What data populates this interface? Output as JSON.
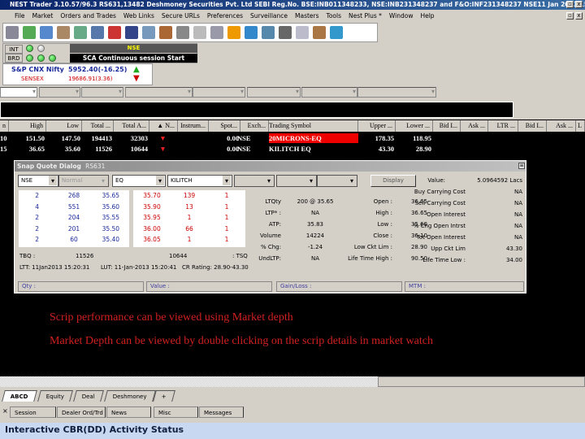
{
  "app": {
    "title": "NEST Trader 3.10.57/96.3 RS631,13482 Deshmoney Securities Pvt. Ltd SEBI Reg.No. BSE:INB011348233, NSE:INB231348237 and F&O:INF231348237 NSE11 Jan 2013 15..."
  },
  "menu": [
    "File",
    "Market",
    "Orders and Trades",
    "Web Links",
    "Secure URLs",
    "Preferences",
    "Surveillance",
    "Masters",
    "Tools",
    "Nest Plus *",
    "Window",
    "Help"
  ],
  "status": {
    "int_label": "INT",
    "brd_label": "BRD",
    "exchange": "NSE",
    "message": "SCA Continuous session Start"
  },
  "ticker": {
    "nifty_name": "S&P CNX Nifty",
    "nifty_value": "5952.40(-16.25)",
    "sensex_name": "SENSEX",
    "sensex_value": "19686.91(3.36)"
  },
  "grid": {
    "headers": [
      "n",
      "High",
      "Low",
      "Total ...",
      "Total A...",
      "▲ N...",
      "Instrum...",
      "Spot...",
      "Exch...",
      "Trading Symbol",
      "Upper ...",
      "Lower ...",
      "Bid I...",
      "Ask ...",
      "LTR ...",
      "Bid I...",
      "Ask ...",
      "L"
    ],
    "rows": [
      {
        "c0": "10",
        "high": "151.50",
        "low": "147.50",
        "total": "194413",
        "totala": "32303",
        "arrow": "▼",
        "spot": "0.00",
        "exch": "NSE",
        "symbol": "20MICRONS-EQ",
        "upper": "178.35",
        "lower": "118.95"
      },
      {
        "c0": "15",
        "high": "36.65",
        "low": "35.60",
        "total": "11526",
        "totala": "10644",
        "arrow": "▼",
        "spot": "0.00",
        "exch": "NSE",
        "symbol": "KILITCH EQ",
        "upper": "43.30",
        "lower": "28.90"
      }
    ]
  },
  "snap": {
    "title": "Snap Quote Dialog",
    "code": "RS631",
    "combos": [
      "NSE",
      "Normal",
      "EQ",
      "KILITCH",
      "",
      "",
      "",
      ""
    ],
    "display_button": "Display",
    "bids": [
      [
        "2",
        "268",
        "35.65"
      ],
      [
        "4",
        "551",
        "35.60"
      ],
      [
        "2",
        "204",
        "35.55"
      ],
      [
        "2",
        "201",
        "35.50"
      ],
      [
        "2",
        "60",
        "35.40"
      ]
    ],
    "asks": [
      [
        "35.70",
        "139",
        "1"
      ],
      [
        "35.90",
        "13",
        "1"
      ],
      [
        "35.95",
        "1",
        "1"
      ],
      [
        "36.00",
        "66",
        "1"
      ],
      [
        "36.05",
        "1",
        "1"
      ]
    ],
    "mid": [
      [
        "LTQty",
        "200 @ 35.65",
        "Open :",
        "36.65"
      ],
      [
        "LTP* :",
        "NA",
        "High :",
        "36.65"
      ],
      [
        "ATP:",
        "35.83",
        "Low :",
        "35.60"
      ],
      [
        "Volume",
        "14224",
        "Close :",
        "36.10"
      ],
      [
        "% Chg:",
        "-1.24",
        "Low Ckt Lim :",
        "28.90"
      ],
      [
        "UndLTP:",
        "NA",
        "Life Time High :",
        "90.50"
      ]
    ],
    "right": [
      [
        "Value:",
        "5.0964592 Lacs"
      ],
      [
        "Buy Carrying Cost",
        "NA"
      ],
      [
        "Sell Carrying Cost",
        "NA"
      ],
      [
        "Open Interest",
        "NA"
      ],
      [
        "% Chg Open Intrst",
        "NA"
      ],
      [
        "Tot Open Interest",
        "NA"
      ],
      [
        "Upp Ckt Lim",
        "43.30"
      ],
      [
        "Life Time Low :",
        "34.00"
      ]
    ],
    "tbq_label": "TBQ :",
    "tbq": "11526",
    "tsq": "10644",
    "tsq_label": ": TSQ",
    "ltt": "LTT: 11Jan2013 15:20:31",
    "lut": "LUT: 11-Jan-2013 15:20:41",
    "cr": "CR Rating: 28.90-43.30",
    "fields": [
      "Qty :",
      "Value :",
      "Gain/Loss :",
      "MTM :"
    ]
  },
  "notes": [
    "Scrip performance can be viewed using Market depth",
    "Market Depth can be viewed by double clicking on the scrip details in market watch"
  ],
  "workspace_tabs": [
    "ABCD",
    "Equity",
    "Deal",
    "Deshmoney",
    "+"
  ],
  "bottom_tabs": [
    "Session",
    "Dealer Ord/Trd",
    "News",
    "Misc",
    "Messages"
  ],
  "bottom_close": "×",
  "activity": "Interactive CBR(DD) Activity Status"
}
